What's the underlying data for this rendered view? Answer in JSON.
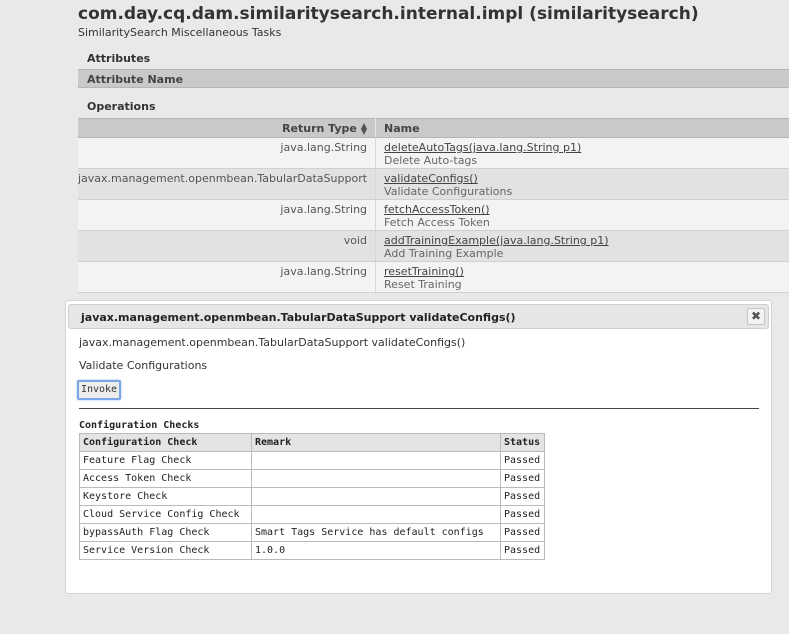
{
  "header": {
    "title": "com.day.cq.dam.similaritysearch.internal.impl (similaritysearch)",
    "subtitle": "SimilaritySearch Miscellaneous Tasks"
  },
  "attributes": {
    "heading": "Attributes",
    "column": "Attribute Name"
  },
  "operations": {
    "heading": "Operations",
    "columns": {
      "return_type": "Return Type",
      "name": "Name"
    },
    "rows": [
      {
        "return_type": "java.lang.String",
        "name": "deleteAutoTags(java.lang.String p1)",
        "description": "Delete Auto-tags"
      },
      {
        "return_type": "javax.management.openmbean.TabularDataSupport",
        "name": "validateConfigs()",
        "description": "Validate Configurations"
      },
      {
        "return_type": "java.lang.String",
        "name": "fetchAccessToken()",
        "description": "Fetch Access Token"
      },
      {
        "return_type": "void",
        "name": "addTrainingExample(java.lang.String p1)",
        "description": "Add Training Example"
      },
      {
        "return_type": "java.lang.String",
        "name": "resetTraining()",
        "description": "Reset Training"
      }
    ]
  },
  "dialog": {
    "title": "javax.management.openmbean.TabularDataSupport validateConfigs()",
    "close_label": "✖",
    "signature": "javax.management.openmbean.TabularDataSupport validateConfigs()",
    "description": "Validate Configurations",
    "invoke_label": "Invoke",
    "result": {
      "title": "Configuration Checks",
      "columns": [
        "Configuration Check",
        "Remark",
        "Status"
      ],
      "rows": [
        [
          "Feature Flag Check",
          "",
          "Passed"
        ],
        [
          "Access Token Check",
          "",
          "Passed"
        ],
        [
          "Keystore Check",
          "",
          "Passed"
        ],
        [
          "Cloud Service Config Check",
          "",
          "Passed"
        ],
        [
          "bypassAuth Flag Check",
          "Smart Tags Service has default configs",
          "Passed"
        ],
        [
          "Service Version Check",
          "1.0.0",
          "Passed"
        ]
      ]
    }
  }
}
